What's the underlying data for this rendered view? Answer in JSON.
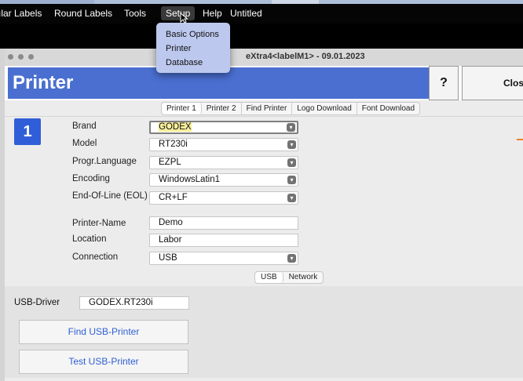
{
  "menubar": {
    "items": [
      "ılar Labels",
      "Round Labels",
      "Tools",
      "Setup",
      "Help",
      "Untitled"
    ],
    "active": "Setup"
  },
  "dropdown": {
    "items": [
      "Basic Options",
      "Printer",
      "Database"
    ]
  },
  "window": {
    "title": "eXtra4<labelM1> - 09.01.2023"
  },
  "header": {
    "title": "Printer",
    "help_label": "?",
    "close_label": "Clos"
  },
  "tabs": [
    "Printer 1",
    "Printer 2",
    "Find Printer",
    "Logo Download",
    "Font Download"
  ],
  "selected_tab": "Printer 1",
  "printer_number": "1",
  "form": {
    "brand_label": "Brand",
    "brand_value": "GODEX",
    "model_label": "Model",
    "model_value": "RT230i",
    "language_label": "Progr.Language",
    "language_value": "EZPL",
    "encoding_label": "Encoding",
    "encoding_value": "WindowsLatin1",
    "eol_label": "End-Of-Line (EOL)",
    "eol_value": "CR+LF",
    "printer_name_label": "Printer-Name",
    "printer_name_value": "Demo",
    "location_label": "Location",
    "location_value": "Labor",
    "connection_label": "Connection",
    "connection_value": "USB"
  },
  "subtabs": [
    "USB",
    "Network"
  ],
  "selected_subtab": "USB",
  "usb": {
    "driver_label": "USB-Driver",
    "driver_value": "GODEX.RT230i",
    "find_button": "Find USB-Printer",
    "test_button": "Test USB-Printer"
  },
  "colors": {
    "header_blue": "#4a6fd0",
    "number_badge_blue": "#2f5ed8",
    "button_text_blue": "#2d5fd4",
    "highlight_yellow": "#f8ef9c",
    "menu_dropdown_bg": "#bdc8ee"
  }
}
